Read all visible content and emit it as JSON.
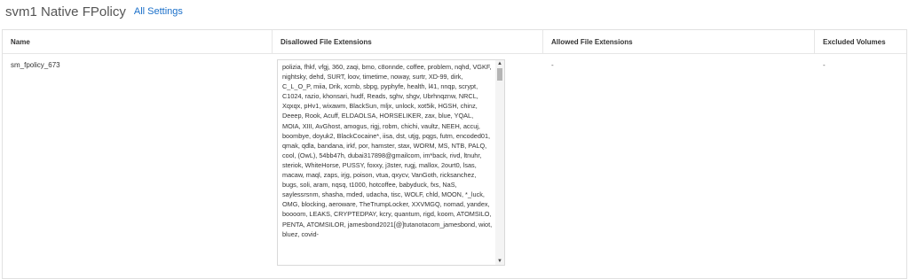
{
  "header": {
    "title": "svm1 Native FPolicy",
    "settings_link": "All Settings"
  },
  "table": {
    "columns": [
      "Name",
      "Disallowed File Extensions",
      "Allowed File Extensions",
      "Excluded Volumes"
    ],
    "rows": [
      {
        "name": "sm_fpolicy_673",
        "disallowed": "polizia, fhkf, vfgj, 360, zaqi, bmo, c8onnde, coffee, problem, nqhd, VGKF, nightsky, dehd, SURT, loov, timetime, noway, surtr, XD-99, dirk, C_L_O_P, miia, Drik, xcmb, sbpg, pyphyfe, health, l41, nnqp, scrypt, C1024, razio, khonsari, hudf, Reads, sghv, shgv, Ubrhnqznw, NRCL, Xqxqx, pHv1, wixawm, BlackSun, mljx, unlock, xot5ik, HGSH, chinz, Deeep, Rook, Acuff, ELDAOLSA, HORSELIKER, zax, blue, YQAL, MOIA, XIII, AvGhost, amogus, rigj, robm, chichi, vaultz, NEEH, accuj, boombye, doyuk2, BlackCocaine*, iisa, dst, utjg, pqgs, futm, encoded01, qmak, qdla, bandana, irkf, por, hamster, stax, WORM, MS, NTB, PALQ, cool, (OwL), 54bb47h, dubai317898@gmailcom, im*back, rivd, ltnuhr, steriok, WhiteHorse, PUSSY, foxxy, j3ster, rugj, mallox, 2ourt0, lsas, macaw, maql, zaps, irjg, poison, vtua, qxycv, VanGoth, ricksanchez, bugs, soli, aram, nqsq, t1000, hotcoffee, babyduck, fxs, NaS, saylessrsnm, shasha, mded, udacha, tisc, WOLF, chld, MOON, *_luck, OMG, blocking, aeroware, TheTrumpLocker, XXVMGQ, nomad, yandex, boooom, LEAKS, CRYPTEDPAY, kcry, quantum, rigd, koom, ATOMSILO, PENTA, ATOMSILOR, jamesbond2021[@]tutanotacom_jamesbond, wiot, bluez, covid-",
        "allowed": "-",
        "excluded": "-"
      }
    ]
  },
  "icons": {
    "scroll_up": "▲",
    "scroll_down": "▼"
  }
}
